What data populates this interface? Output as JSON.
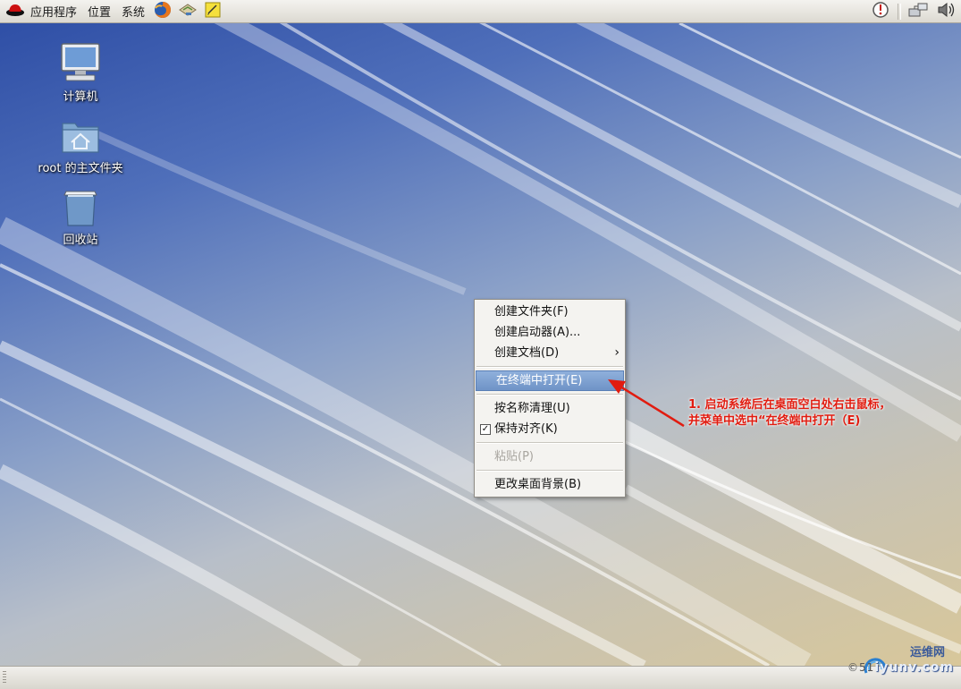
{
  "top_panel": {
    "menus": [
      "应用程序",
      "位置",
      "系统"
    ],
    "launcher_icons": [
      "firefox-icon",
      "mail-icon",
      "notes-icon"
    ],
    "tray_icons": [
      "update-icon",
      "network-icon",
      "volume-icon"
    ]
  },
  "desktop": {
    "icons": [
      {
        "label": "计算机",
        "icon": "computer-icon"
      },
      {
        "label": "root 的主文件夹",
        "icon": "home-folder-icon"
      },
      {
        "label": "回收站",
        "icon": "trash-icon"
      }
    ]
  },
  "context_menu": {
    "items": [
      {
        "label": "创建文件夹(F)"
      },
      {
        "label": "创建启动器(A)..."
      },
      {
        "label": "创建文档(D)",
        "submenu_arrow": "›"
      },
      {
        "label": "在终端中打开(E)"
      },
      {
        "label": "按名称清理(U)"
      },
      {
        "label": "保持对齐(K)",
        "checked": true,
        "check_mark": "✓"
      },
      {
        "label": "粘贴(P)"
      },
      {
        "label": "更改桌面背景(B)"
      }
    ],
    "highlighted_item": "在终端中打开(E)",
    "disabled_item": "粘贴(P)"
  },
  "annotation": {
    "line1": "1. 启动系统后在桌面空白处右击鼠标，",
    "line2": "并菜单中选中“在终端中打开（E)",
    "color": "#e11c10"
  },
  "watermark": {
    "top": "运维网",
    "bottom": "iyunv.com",
    "prefix": "©51"
  },
  "colors": {
    "highlight": "#7a9bcf",
    "annotation": "#e11c10",
    "panel": "#e8e6e0"
  }
}
